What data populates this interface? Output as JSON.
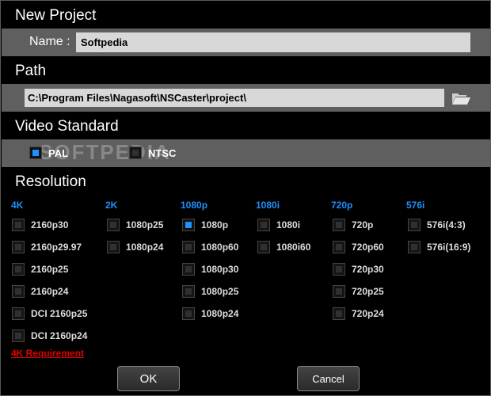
{
  "new_project": {
    "title": "New Project",
    "name_label": "Name :",
    "name_value": "Softpedia"
  },
  "path": {
    "title": "Path",
    "value": "C:\\Program Files\\Nagasoft\\NSCaster\\project\\",
    "icon": "folder-open-icon"
  },
  "video_standard": {
    "title": "Video Standard",
    "options": [
      {
        "label": "PAL",
        "checked": true
      },
      {
        "label": "NTSC",
        "checked": false
      }
    ]
  },
  "watermark": "SOFTPEDIA",
  "resolution": {
    "title": "Resolution",
    "groups": [
      {
        "heading": "4K",
        "items": [
          "2160p30",
          "2160p29.97",
          "2160p25",
          "2160p24",
          "DCI 2160p25",
          "DCI 2160p24"
        ]
      },
      {
        "heading": "2K",
        "items": [
          "1080p25",
          "1080p24"
        ]
      },
      {
        "heading": "1080p",
        "items": [
          "1080p",
          "1080p60",
          "1080p30",
          "1080p25",
          "1080p24"
        ]
      },
      {
        "heading": "1080i",
        "items": [
          "1080i",
          "1080i60"
        ]
      },
      {
        "heading": "720p",
        "items": [
          "720p",
          "720p60",
          "720p30",
          "720p25",
          "720p24"
        ]
      },
      {
        "heading": "576i",
        "items": [
          "576i(4:3)",
          "576i(16:9)"
        ]
      }
    ],
    "selected": "1080p",
    "requirement_link": "4K Requirement"
  },
  "buttons": {
    "ok": "OK",
    "cancel": "Cancel"
  },
  "colors": {
    "accent": "#1f8fff",
    "link": "#e00000",
    "band": "#5f5f5f",
    "field": "#d8d8d8"
  }
}
